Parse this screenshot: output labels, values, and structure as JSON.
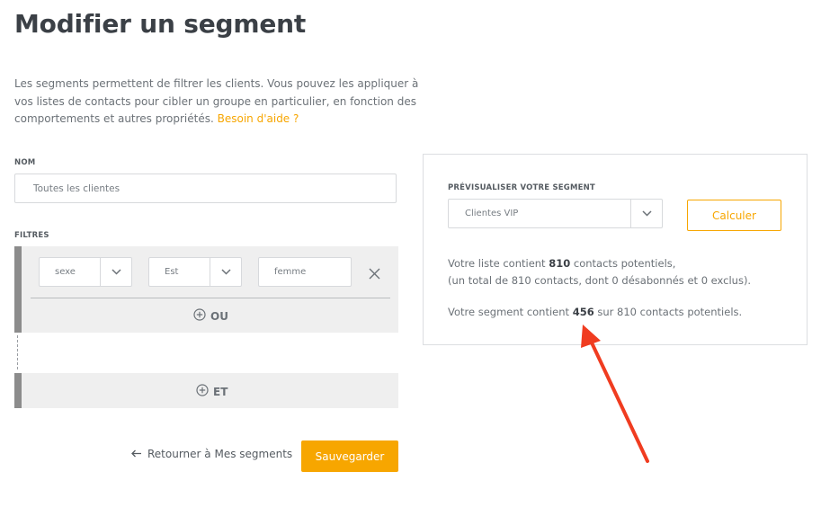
{
  "page": {
    "title": "Modifier un segment",
    "description": "Les segments permettent de filtrer les clients. Vous pouvez les appliquer à vos listes de contacts pour cibler un groupe en particulier, en fonction des comportements et autres propriétés.",
    "help_link": "Besoin d'aide ?"
  },
  "form": {
    "name_label": "NOM",
    "name_value": "Toutes les clientes",
    "filters_label": "FILTRES",
    "filter": {
      "field": "sexe",
      "operator": "Est",
      "value": "femme"
    },
    "or_label": "OU",
    "and_label": "ET",
    "back_label": "Retourner à Mes segments",
    "save_label": "Sauvegarder"
  },
  "preview": {
    "label": "PRÉVISUALISER VOTRE SEGMENT",
    "list_selected": "Clientes VIP",
    "calc_label": "Calculer",
    "list_line1_prefix": "Votre liste contient ",
    "list_count": "810",
    "list_line1_suffix": " contacts potentiels,",
    "list_line2": "(un total de 810 contacts, dont 0 désabonnés et 0 exclus).",
    "segment_prefix": "Votre segment contient ",
    "segment_count": "456",
    "segment_suffix": " sur 810 contacts potentiels."
  },
  "colors": {
    "accent": "#f7a600",
    "annotation_arrow": "#f03c20"
  }
}
